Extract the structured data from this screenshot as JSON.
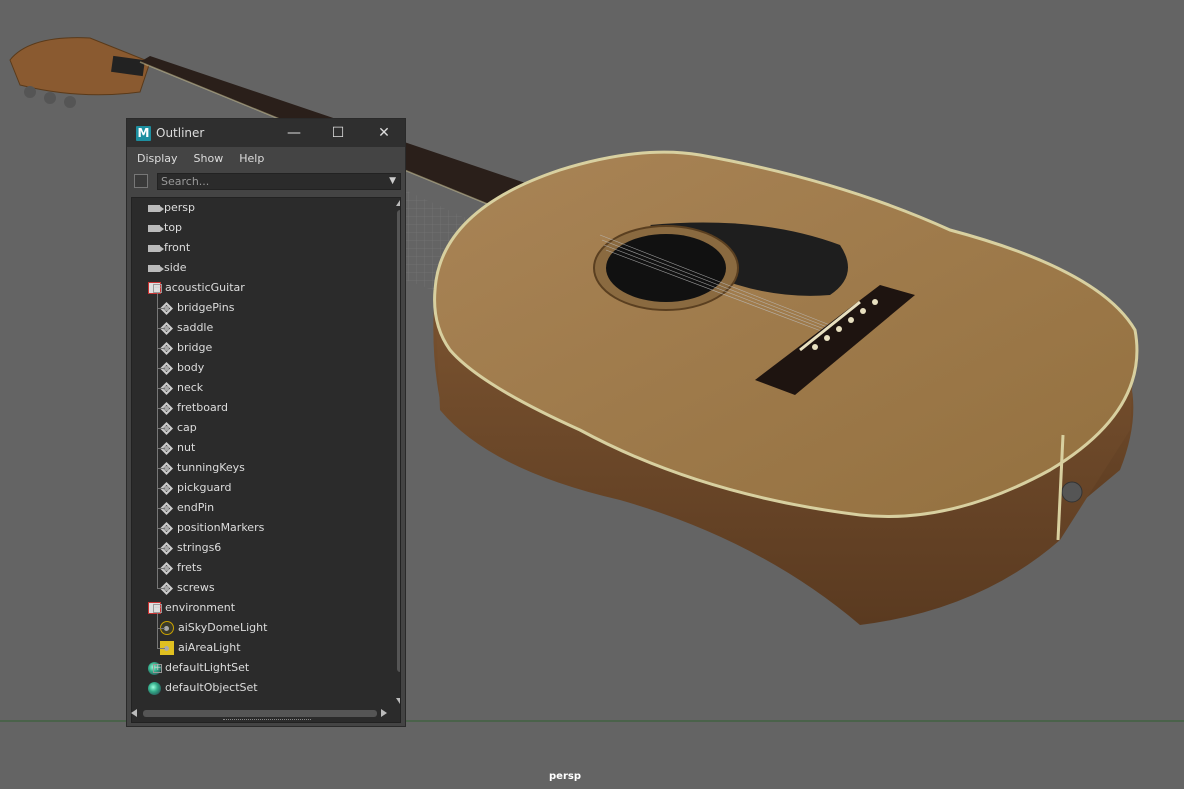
{
  "window": {
    "title": "Outliner",
    "logo": "M",
    "minimize_glyph": "—",
    "maximize_glyph": "☐",
    "close_glyph": "✕"
  },
  "menu": [
    "Display",
    "Show",
    "Help"
  ],
  "search": {
    "placeholder": "Search..."
  },
  "viewport": {
    "camera_label": "persp"
  },
  "tree": [
    {
      "label": "persp",
      "icon": "camera-icon",
      "level": 0
    },
    {
      "label": "top",
      "icon": "camera-icon",
      "level": 0
    },
    {
      "label": "front",
      "icon": "camera-icon",
      "level": 0
    },
    {
      "label": "side",
      "icon": "camera-icon",
      "level": 0
    },
    {
      "label": "acousticGuitar",
      "icon": "group-icon",
      "level": 0,
      "expanded": true
    },
    {
      "label": "bridgePins",
      "icon": "mesh-icon",
      "level": 1
    },
    {
      "label": "saddle",
      "icon": "mesh-icon",
      "level": 1
    },
    {
      "label": "bridge",
      "icon": "mesh-icon",
      "level": 1
    },
    {
      "label": "body",
      "icon": "mesh-icon",
      "level": 1
    },
    {
      "label": "neck",
      "icon": "mesh-icon",
      "level": 1
    },
    {
      "label": "fretboard",
      "icon": "mesh-icon",
      "level": 1
    },
    {
      "label": "cap",
      "icon": "mesh-icon",
      "level": 1
    },
    {
      "label": "nut",
      "icon": "mesh-icon",
      "level": 1
    },
    {
      "label": "tunningKeys",
      "icon": "mesh-icon",
      "level": 1
    },
    {
      "label": "pickguard",
      "icon": "mesh-icon",
      "level": 1
    },
    {
      "label": "endPin",
      "icon": "mesh-icon",
      "level": 1
    },
    {
      "label": "positionMarkers",
      "icon": "mesh-icon",
      "level": 1
    },
    {
      "label": "strings6",
      "icon": "mesh-icon",
      "level": 1
    },
    {
      "label": "frets",
      "icon": "mesh-icon",
      "level": 1
    },
    {
      "label": "screws",
      "icon": "mesh-icon",
      "level": 1
    },
    {
      "label": "environment",
      "icon": "group-icon",
      "level": 0,
      "expanded": true
    },
    {
      "label": "aiSkyDomeLight",
      "icon": "skydome-light-icon",
      "level": 1
    },
    {
      "label": "aiAreaLight",
      "icon": "area-light-icon",
      "level": 1
    },
    {
      "label": "defaultLightSet",
      "icon": "set-icon",
      "level": 0,
      "collapsed": true
    },
    {
      "label": "defaultObjectSet",
      "icon": "set-icon",
      "level": 0
    }
  ],
  "colors": {
    "viewport_bg": "#646464",
    "panel_bg": "#444444",
    "tree_bg": "#2b2b2b",
    "wood_top": "#a07a4c",
    "wood_side": "#6b4526",
    "fretboard": "#2a1f1a",
    "binding": "#d8d0a0",
    "horizon": "#2f5f2f"
  }
}
